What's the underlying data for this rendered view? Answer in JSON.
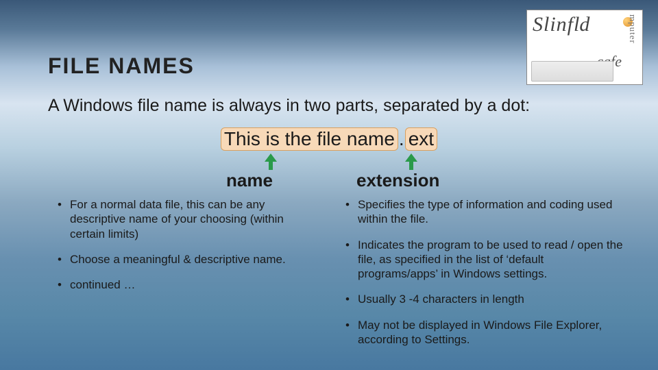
{
  "logo": {
    "brand": "Slinf",
    "vertical": "ld",
    "side": "mputer",
    "sub": "cafe"
  },
  "title": "FILE NAMES",
  "intro": "A Windows file name is always in two parts, separated by a dot:",
  "example": {
    "name_part": "This is the file name",
    "dot": ".",
    "ext_part": "ext"
  },
  "columns": {
    "left": {
      "heading": "name",
      "items": [
        "For a normal data file, this can be any descriptive name of your choosing (within certain limits)",
        "Choose a meaningful & descriptive name.",
        "continued …"
      ]
    },
    "right": {
      "heading": "extension",
      "items": [
        "Specifies the type of information and coding used within the file.",
        "Indicates the program to be used to read / open the file, as specified in the list of ‘default programs/apps’ in Windows settings.",
        "Usually 3 -4 characters in length",
        "May not be displayed in Windows File Explorer, according to Settings."
      ]
    }
  }
}
